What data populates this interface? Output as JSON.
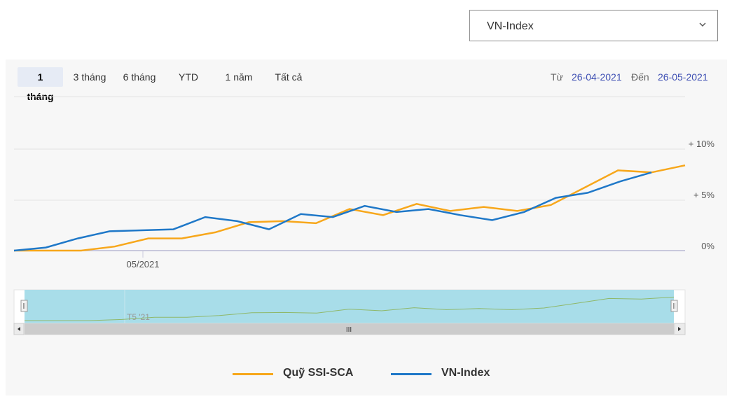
{
  "benchmark_select": {
    "value": "VN-Index"
  },
  "range_buttons": [
    {
      "label": "1 tháng",
      "active": true
    },
    {
      "label": "3 tháng",
      "active": false
    },
    {
      "label": "6 tháng",
      "active": false
    },
    {
      "label": "YTD",
      "active": false
    },
    {
      "label": "1 năm",
      "active": false
    },
    {
      "label": "Tất cả",
      "active": false
    }
  ],
  "date_range": {
    "from_label": "Từ",
    "from_value": "26-04-2021",
    "to_label": "Đến",
    "to_value": "26-05-2021"
  },
  "navigator": {
    "tick_label": "T5 '21",
    "scrollbar_grip": "III"
  },
  "colors": {
    "fund": "#f7a71b",
    "index": "#1f78c8",
    "navigator_fill": "#a8dde9"
  },
  "chart_data": {
    "type": "line",
    "x": [
      "2021-04-26",
      "2021-04-27",
      "2021-04-28",
      "2021-04-29",
      "2021-05-04",
      "2021-05-05",
      "2021-05-06",
      "2021-05-07",
      "2021-05-10",
      "2021-05-11",
      "2021-05-12",
      "2021-05-13",
      "2021-05-14",
      "2021-05-17",
      "2021-05-18",
      "2021-05-19",
      "2021-05-20",
      "2021-05-21",
      "2021-05-24",
      "2021-05-25",
      "2021-05-26"
    ],
    "x_tick_labels": [
      "05/2021"
    ],
    "y_tick_labels": [
      "0%",
      "+ 5%",
      "+ 10%"
    ],
    "ylim": [
      0,
      10
    ],
    "series": [
      {
        "name": "Quỹ SSI-SCA",
        "values": [
          0,
          0,
          0,
          0.4,
          1.2,
          1.2,
          1.8,
          2.8,
          2.9,
          2.7,
          4.1,
          3.5,
          4.6,
          3.9,
          4.3,
          3.9,
          4.5,
          6.2,
          7.9,
          7.7,
          8.4
        ]
      },
      {
        "name": "VN-Index",
        "values": [
          0,
          0.3,
          1.2,
          1.9,
          2.0,
          2.1,
          3.3,
          2.9,
          2.1,
          3.6,
          3.3,
          4.4,
          3.8,
          4.1,
          3.5,
          3.0,
          3.8,
          5.2,
          5.7,
          6.8,
          7.7
        ]
      }
    ],
    "grid": true,
    "legend": "bottom"
  }
}
